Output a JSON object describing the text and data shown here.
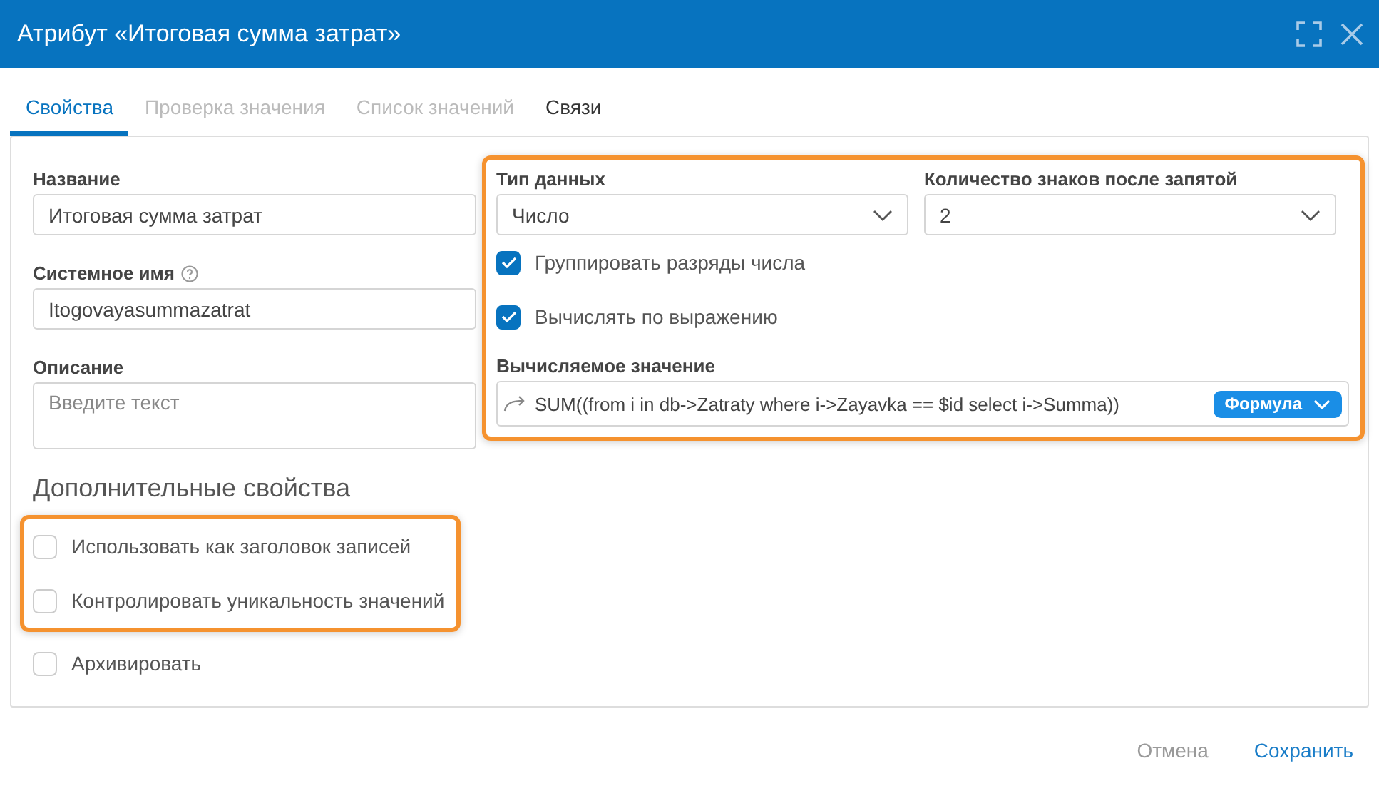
{
  "window": {
    "title": "Атрибут «Итоговая сумма затрат»"
  },
  "tabs": [
    {
      "label": "Свойства",
      "selected": true,
      "disabled": false
    },
    {
      "label": "Проверка значения",
      "selected": false,
      "disabled": true
    },
    {
      "label": "Список значений",
      "selected": false,
      "disabled": true
    },
    {
      "label": "Связи",
      "selected": false,
      "disabled": false
    }
  ],
  "fields": [
    {
      "label": "Название",
      "kind": "text",
      "value": "Итоговая сумма затрат",
      "help": false
    },
    {
      "label": "Системное имя",
      "kind": "text",
      "value": "Itogovayasummazatrat",
      "help": true
    },
    {
      "label": "Описание",
      "kind": "textarea",
      "placeholder": "Введите текст",
      "help": false
    }
  ],
  "type_settings": {
    "highlighted": true,
    "data_type": {
      "label": "Тип данных",
      "value": "Число"
    },
    "decimals": {
      "label": "Количество знаков после запятой",
      "value": "2"
    },
    "options": [
      {
        "label": "Группировать разряды числа",
        "checked": true
      },
      {
        "label": "Вычислять по выражению",
        "checked": true
      }
    ],
    "expression": {
      "label": "Вычисляемое значение",
      "value": "SUM((from i in db->Zatraty where i->Zayavka == $id select i->Summa))",
      "mode": "Формула"
    }
  },
  "extra": {
    "title": "Дополнительные свойства",
    "options": [
      {
        "label": "Использовать как заголовок записей",
        "checked": false,
        "highlighted": true
      },
      {
        "label": "Контролировать уникальность значений",
        "checked": false,
        "highlighted": true
      },
      {
        "label": "Архивировать",
        "checked": false,
        "highlighted": false
      }
    ]
  },
  "buttons": [
    {
      "label": "Отмена",
      "kind": "secondary"
    },
    {
      "label": "Сохранить",
      "kind": "primary"
    }
  ]
}
